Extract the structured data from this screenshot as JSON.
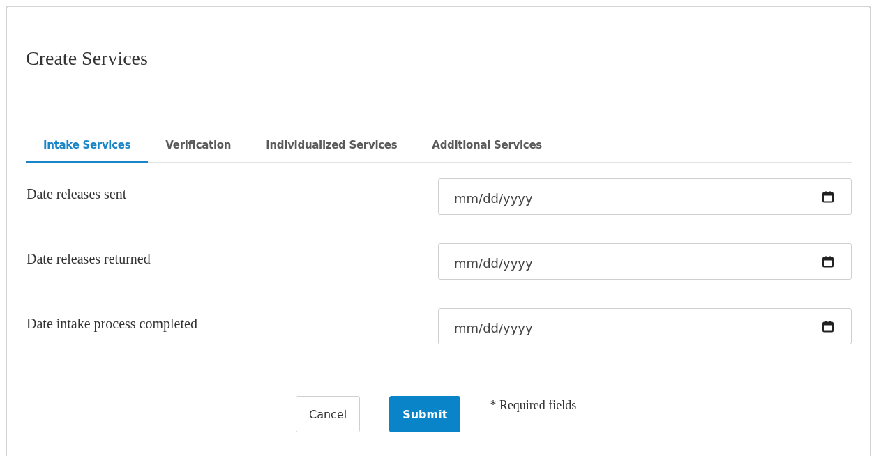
{
  "dialog": {
    "title": "Create Services"
  },
  "tabs": [
    {
      "label": "Intake Services",
      "selected": true
    },
    {
      "label": "Verification",
      "selected": false
    },
    {
      "label": "Individualized Services",
      "selected": false
    },
    {
      "label": "Additional Services",
      "selected": false
    }
  ],
  "fields": [
    {
      "label": "Date releases sent",
      "placeholder": "mm/dd/yyyy"
    },
    {
      "label": "Date releases returned",
      "placeholder": "mm/dd/yyyy"
    },
    {
      "label": "Date intake process completed",
      "placeholder": "mm/dd/yyyy"
    }
  ],
  "buttons": [
    {
      "label": "Cancel",
      "kind": "secondary"
    },
    {
      "label": "Submit",
      "kind": "primary"
    }
  ],
  "note": "* Required fields"
}
